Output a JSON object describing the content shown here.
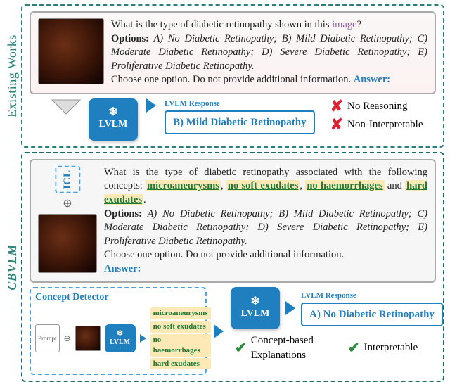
{
  "labels": {
    "existing": "Existing Works",
    "cbvlm": "CBVLM",
    "lvlm": "LVLM",
    "icl": "ICL",
    "response_label": "LVLM Response",
    "concept_detector": "Concept Detector",
    "prompt_mini": "Prompt"
  },
  "top": {
    "question_pre": "What is the type of diabetic retinopathy shown in this ",
    "image_word": "image",
    "question_post": "?",
    "options_label": "Options:",
    "options_text": " A) No Diabetic Retinopathy; B) Mild Diabetic Retinopathy; C) Moderate Diabetic Retinopathy; D) Severe Diabetic Retinopathy; E) Proliferative Diabetic Retinopathy.",
    "instruction": "Choose one option. Do not provide additional information. ",
    "answer_word": "Answer:",
    "response": "B) Mild Diabetic Retinopathy",
    "crit1": "No Reasoning",
    "crit2": "Non-Interpretable"
  },
  "bot": {
    "question_pre": "What is the type of diabetic retinopathy associated with the following concepts: ",
    "c1": "microaneurysms",
    "c2": "no soft exudates",
    "c3": "no haemorrhages",
    "c4": "hard exudates",
    "sep_comma": ", ",
    "sep_and": " and ",
    "period": ".",
    "options_label": "Options:",
    "options_text": " A) No Diabetic Retinopathy; B) Mild Diabetic Retinopathy; C) Moderate Diabetic Retinopathy; D) Severe Diabetic Retinopathy; E) Proliferative Diabetic Retinopathy.",
    "instruction": "Choose one option. Do not provide additional information.",
    "answer_word": "Answer:",
    "response": "A) No Diabetic Retinopathy",
    "adv1": "Concept-based Explanations",
    "adv2": "Interpretable"
  }
}
